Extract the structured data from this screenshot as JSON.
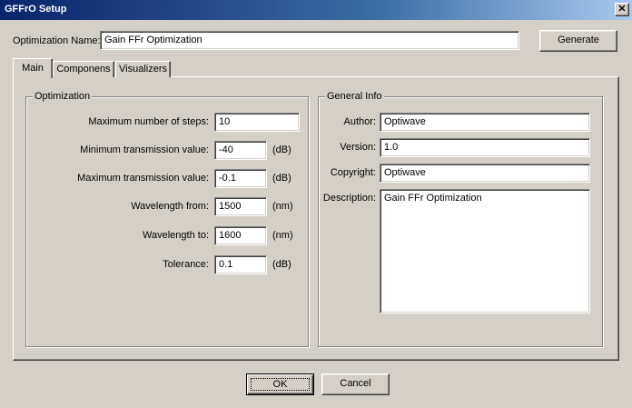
{
  "window": {
    "title": "GFFrO Setup",
    "close_glyph": "✕"
  },
  "header": {
    "name_label": "Optimization Name:",
    "name_value": "Gain FFr Optimization",
    "generate_label": "Generate"
  },
  "tabs": [
    {
      "label": "Main",
      "active": true
    },
    {
      "label": "Componens",
      "active": false
    },
    {
      "label": "Visualizers",
      "active": false
    }
  ],
  "optimization": {
    "title": "Optimization",
    "fields": [
      {
        "label": "Maximum number of steps:",
        "value": "10",
        "unit": ""
      },
      {
        "label": "Minimum transmission value:",
        "value": "-40",
        "unit": "(dB)"
      },
      {
        "label": "Maximum transmission value:",
        "value": "-0.1",
        "unit": "(dB)"
      },
      {
        "label": "Wavelength from:",
        "value": "1500",
        "unit": "(nm)"
      },
      {
        "label": "Wavelength to:",
        "value": "1600",
        "unit": "(nm)"
      },
      {
        "label": "Tolerance:",
        "value": "0.1",
        "unit": "(dB)"
      }
    ]
  },
  "general_info": {
    "title": "General Info",
    "author_label": "Author:",
    "author_value": "Optiwave",
    "version_label": "Version:",
    "version_value": "1.0",
    "copyright_label": "Copyright:",
    "copyright_value": "Optiwave",
    "description_label": "Description:",
    "description_value": "Gain FFr Optimization"
  },
  "footer": {
    "ok_label": "OK",
    "cancel_label": "Cancel"
  }
}
